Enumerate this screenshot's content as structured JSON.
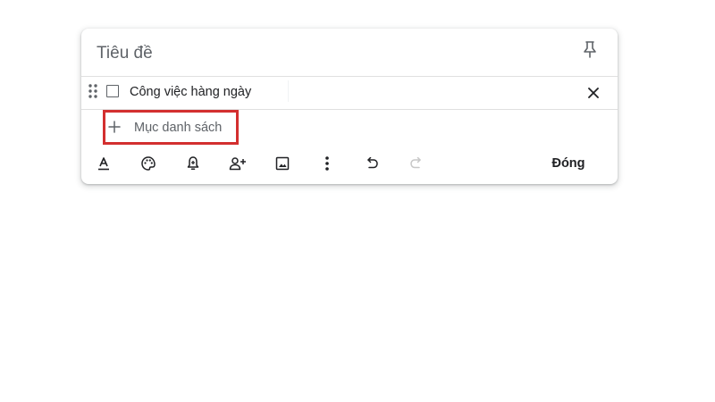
{
  "note": {
    "title": "Tiêu đề",
    "items": [
      {
        "text": "Công việc hàng ngày",
        "checked": false
      }
    ],
    "add_item_placeholder": "Mục danh sách"
  },
  "toolbar": {
    "icons": [
      "text-format-icon",
      "palette-icon",
      "reminder-bell-icon",
      "add-collaborator-icon",
      "add-image-icon",
      "more-options-icon",
      "undo-icon",
      "redo-icon"
    ],
    "close_label": "Đóng"
  },
  "colors": {
    "highlight_border": "#d32f2f",
    "icon": "#5f6368",
    "text": "#202124",
    "disabled_icon": "#c7c7c7"
  }
}
